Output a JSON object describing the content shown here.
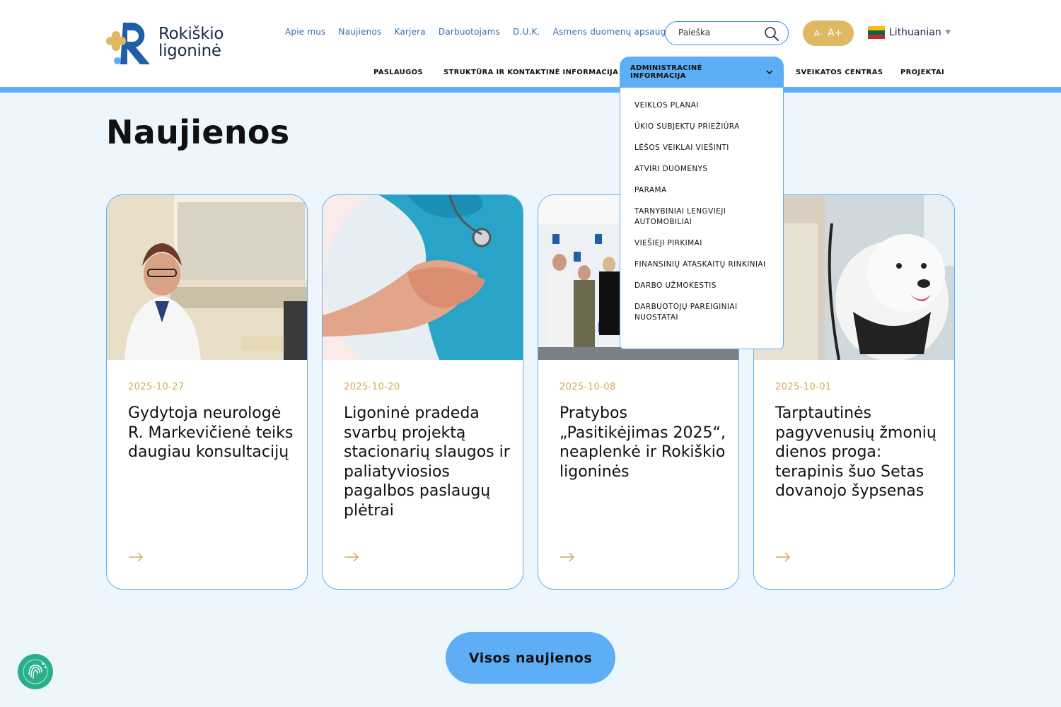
{
  "logo": {
    "line1": "Rokiškio",
    "line2": "ligoninė"
  },
  "toplinks": [
    "Apie mus",
    "Naujienos",
    "Karjera",
    "Darbuotojams",
    "D.U.K.",
    "Asmens duomenų apsauga"
  ],
  "search": {
    "placeholder": "Paieška"
  },
  "fontsize": {
    "decrease": "A-",
    "increase": "A+"
  },
  "language": {
    "label": "Lithuanian"
  },
  "nav": {
    "services": "PASLAUGOS",
    "structure": "STRUKTŪRA IR KONTAKTINĖ INFORMACIJA",
    "admin": "ADMINISTRACINĖ INFORMACIJA",
    "health": "SVEIKATOS CENTRAS",
    "projects": "PROJEKTAI"
  },
  "dropdown": [
    "VEIKLOS PLANAI",
    "ŪKIO SUBJEKTŲ PRIEŽIŪRA",
    "LĖŠOS VEIKLAI VIEŠINTI",
    "ATVIRI DUOMENYS",
    "PARAMA",
    "TARNYBINIAI LENGVIEJI AUTOMOBILIAI",
    "VIEŠIEJI PIRKIMAI",
    "FINANSINIŲ ATASKAITŲ RINKINIAI",
    "DARBO UŽMOKESTIS",
    "DARBUOTOJŲ PAREIGINIAI NUOSTATAI"
  ],
  "page_title": "Naujienos",
  "news": [
    {
      "date": "2025-10-27",
      "title": "Gydytoja neurologė R. Markevičienė teiks daugiau konsultacijų"
    },
    {
      "date": "2025-10-20",
      "title": "Ligoninė pradeda svarbų projektą stacionarių slaugos ir paliatyviosios pagalbos paslaugų plėtrai"
    },
    {
      "date": "2025-10-08",
      "title": "Pratybos „Pasitikėjimas 2025“, neaplenkė ir Rokiškio ligoninės"
    },
    {
      "date": "2025-10-01",
      "title": "Tarptautinės pagyvenusių žmonių dienos proga: terapinis šuo Setas dovanojo šypsenas"
    }
  ],
  "all_news_button": "Visos naujienos",
  "colors": {
    "accent_blue": "#5daef5",
    "gold": "#dfb862",
    "link_blue": "#2f6fb2",
    "a11y_green": "#29b08a"
  }
}
